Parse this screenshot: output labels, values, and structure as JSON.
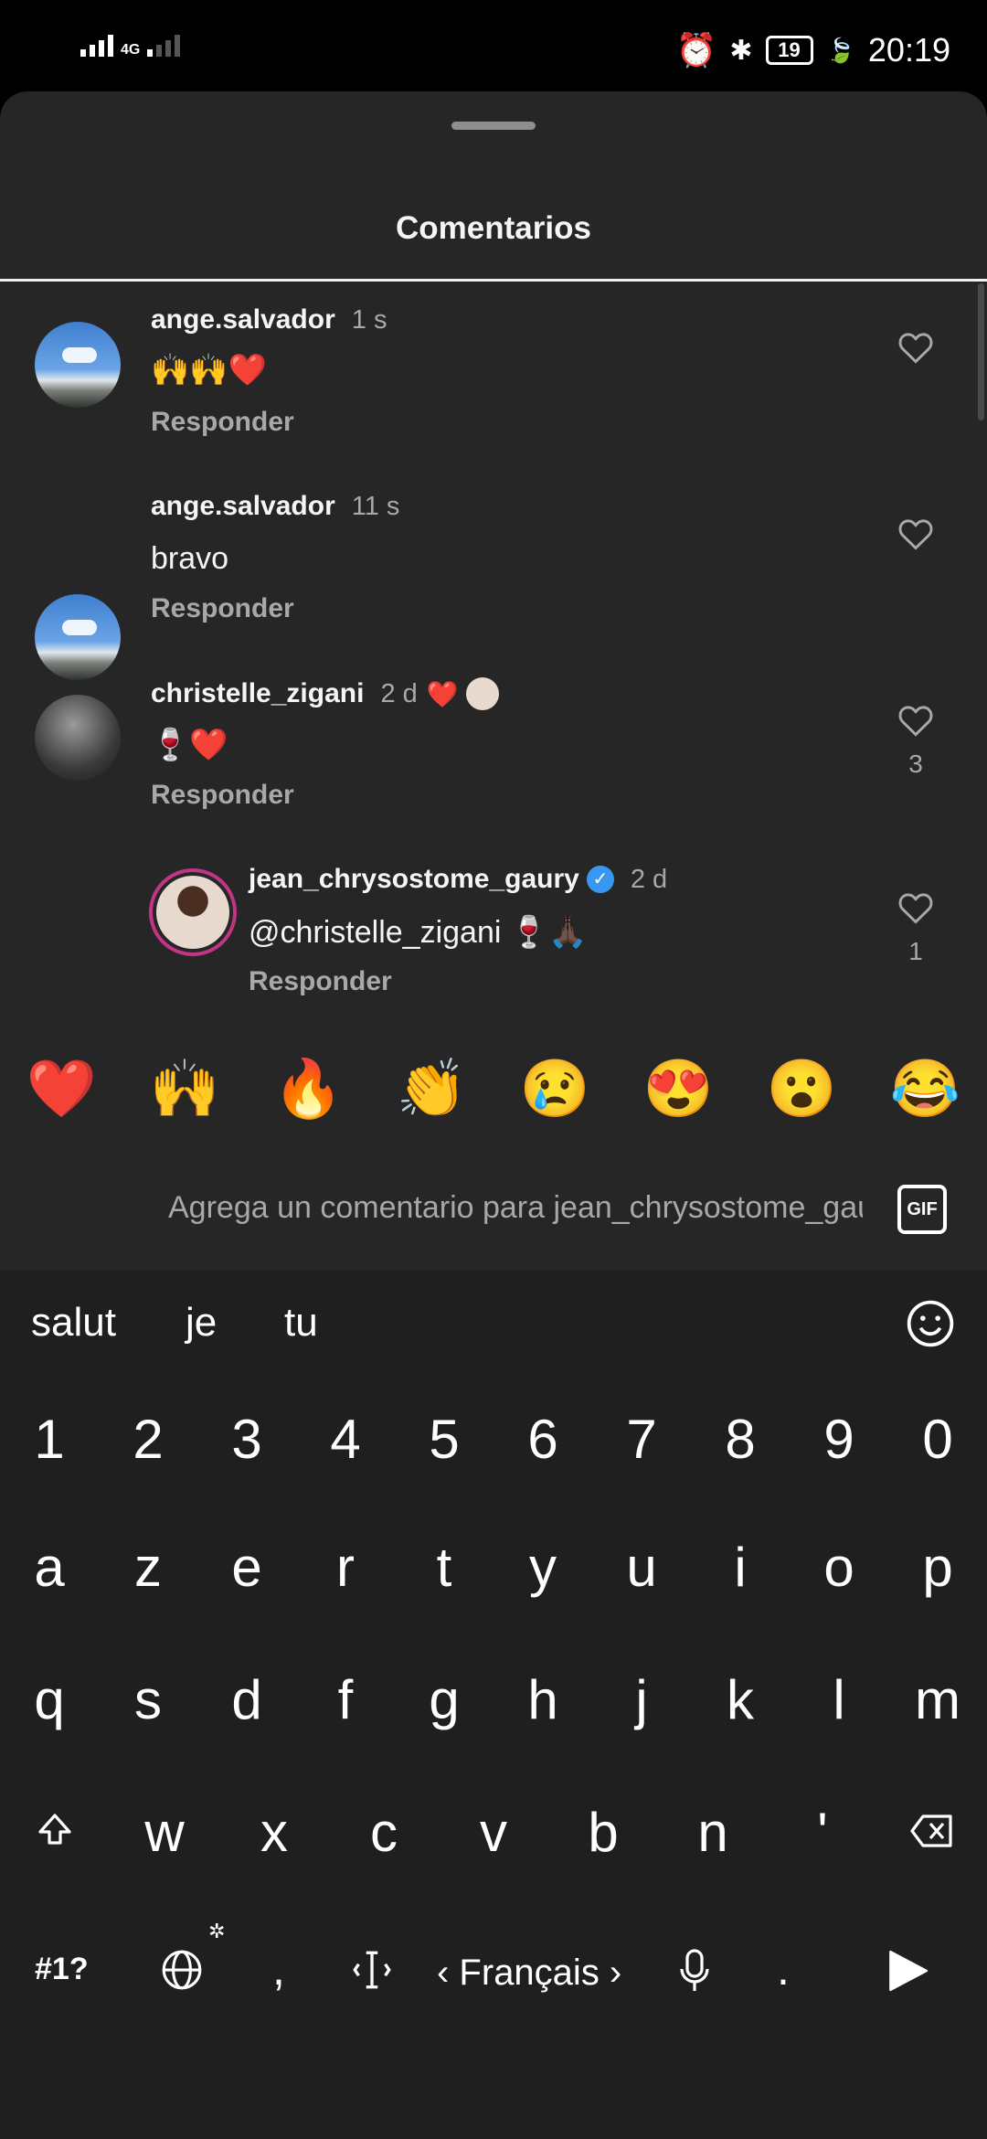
{
  "status_bar": {
    "network": "4G",
    "battery": "19",
    "time": "20:19"
  },
  "sheet": {
    "title": "Comentarios"
  },
  "comments": [
    {
      "user": "ange.salvador",
      "time": "1 s",
      "text": "🙌🙌❤️",
      "reply": "Responder"
    },
    {
      "user": "ange.salvador",
      "time": "11 s",
      "text": "bravo",
      "reply": "Responder"
    },
    {
      "user": "christelle_zigani",
      "time": "2 d",
      "text": "🍷❤️",
      "reply": "Responder",
      "likes": "3",
      "liked_by_creator": "❤️"
    },
    {
      "user": "jean_chrysostome_gaury",
      "time": "2 d",
      "text": "@christelle_zigani 🍷🙏🏿",
      "reply": "Responder",
      "likes": "1",
      "verified": "✓"
    }
  ],
  "quick_emojis": [
    "❤️",
    "🙌",
    "🔥",
    "👏",
    "😢",
    "😍",
    "😮",
    "😂"
  ],
  "input": {
    "placeholder": "Agrega un comentario para jean_chrysostome_gaury...",
    "gif_label": "GIF"
  },
  "keyboard": {
    "suggestions": [
      "salut",
      "je",
      "tu"
    ],
    "numbers": [
      "1",
      "2",
      "3",
      "4",
      "5",
      "6",
      "7",
      "8",
      "9",
      "0"
    ],
    "row1": [
      "a",
      "z",
      "e",
      "r",
      "t",
      "y",
      "u",
      "i",
      "o",
      "p"
    ],
    "row2": [
      "q",
      "s",
      "d",
      "f",
      "g",
      "h",
      "j",
      "k",
      "l",
      "m"
    ],
    "row3": [
      "w",
      "x",
      "c",
      "v",
      "b",
      "n",
      "'"
    ],
    "symbols_label": "#1?",
    "comma": ",",
    "language": "‹ Français ›",
    "period": "."
  }
}
